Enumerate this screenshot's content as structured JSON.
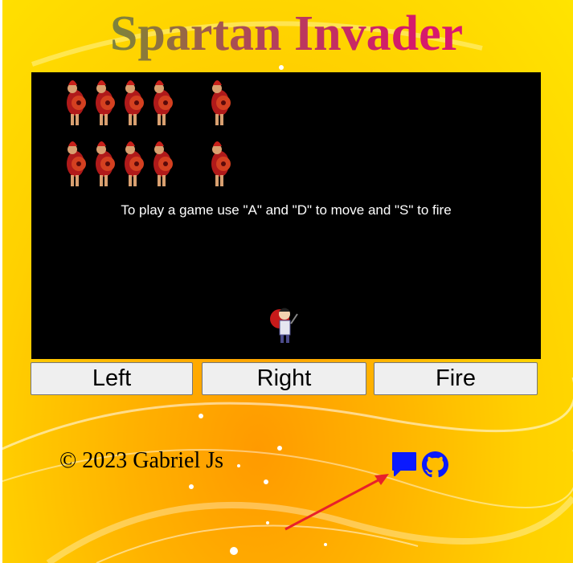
{
  "title": "Spartan Invader",
  "game": {
    "instructions": "To play a game use \"A\" and \"D\" to move and \"S\" to fire"
  },
  "controls": {
    "left_label": "Left",
    "right_label": "Right",
    "fire_label": "Fire"
  },
  "footer": {
    "copyright": "© 2023 Gabriel Js",
    "icons": [
      "chat-icon",
      "github-icon"
    ],
    "icon_color": "#0a1aff"
  },
  "colors": {
    "game_background": "#000000",
    "annotation_arrow": "#e8202a"
  }
}
